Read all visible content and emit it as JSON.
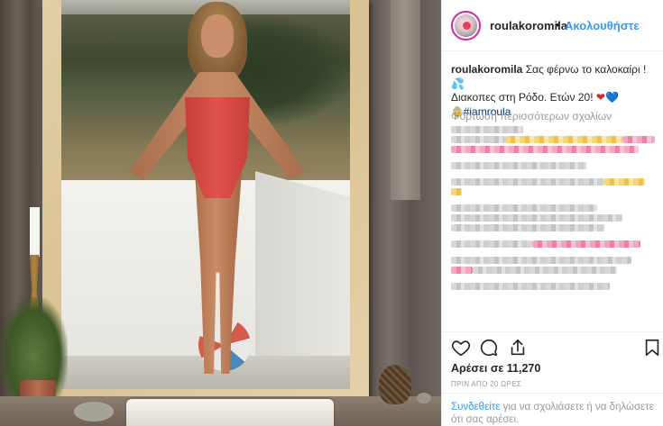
{
  "post": {
    "username": "roulakoromila",
    "follow_separator": "•",
    "follow_label": "Ακολουθήστε",
    "caption_username": "roulakoromila",
    "caption_text": "Σας φέρνω το καλοκαίρι !",
    "caption_emoji_1": "💦",
    "caption_line_2": "Διακοπες στη Ρόδο. Ετών 20!",
    "caption_heart_red": "❤",
    "caption_heart_blue": "💙",
    "caption_emoji_3": "👵",
    "hashtag": "#iamroula",
    "load_more": "Φόρτωση περισσότερων σχολίων",
    "likes": "Αρέσει σε 11,270",
    "time_ago": "ΠΡΙΝ ΑΠΟ 20 ΩΡΕΣ",
    "login_link": "Συνδεθείτε",
    "login_text": " για να σχολιάσετε ή να δηλώσετε ότι σας αρέσει."
  },
  "icons": {
    "like": "heart-outline",
    "comment": "speech-bubble",
    "share": "share-upload",
    "save": "bookmark"
  },
  "colors": {
    "link_blue": "#3897f0",
    "text": "#262626",
    "muted": "#999999",
    "story_ring": "#d6249f"
  }
}
